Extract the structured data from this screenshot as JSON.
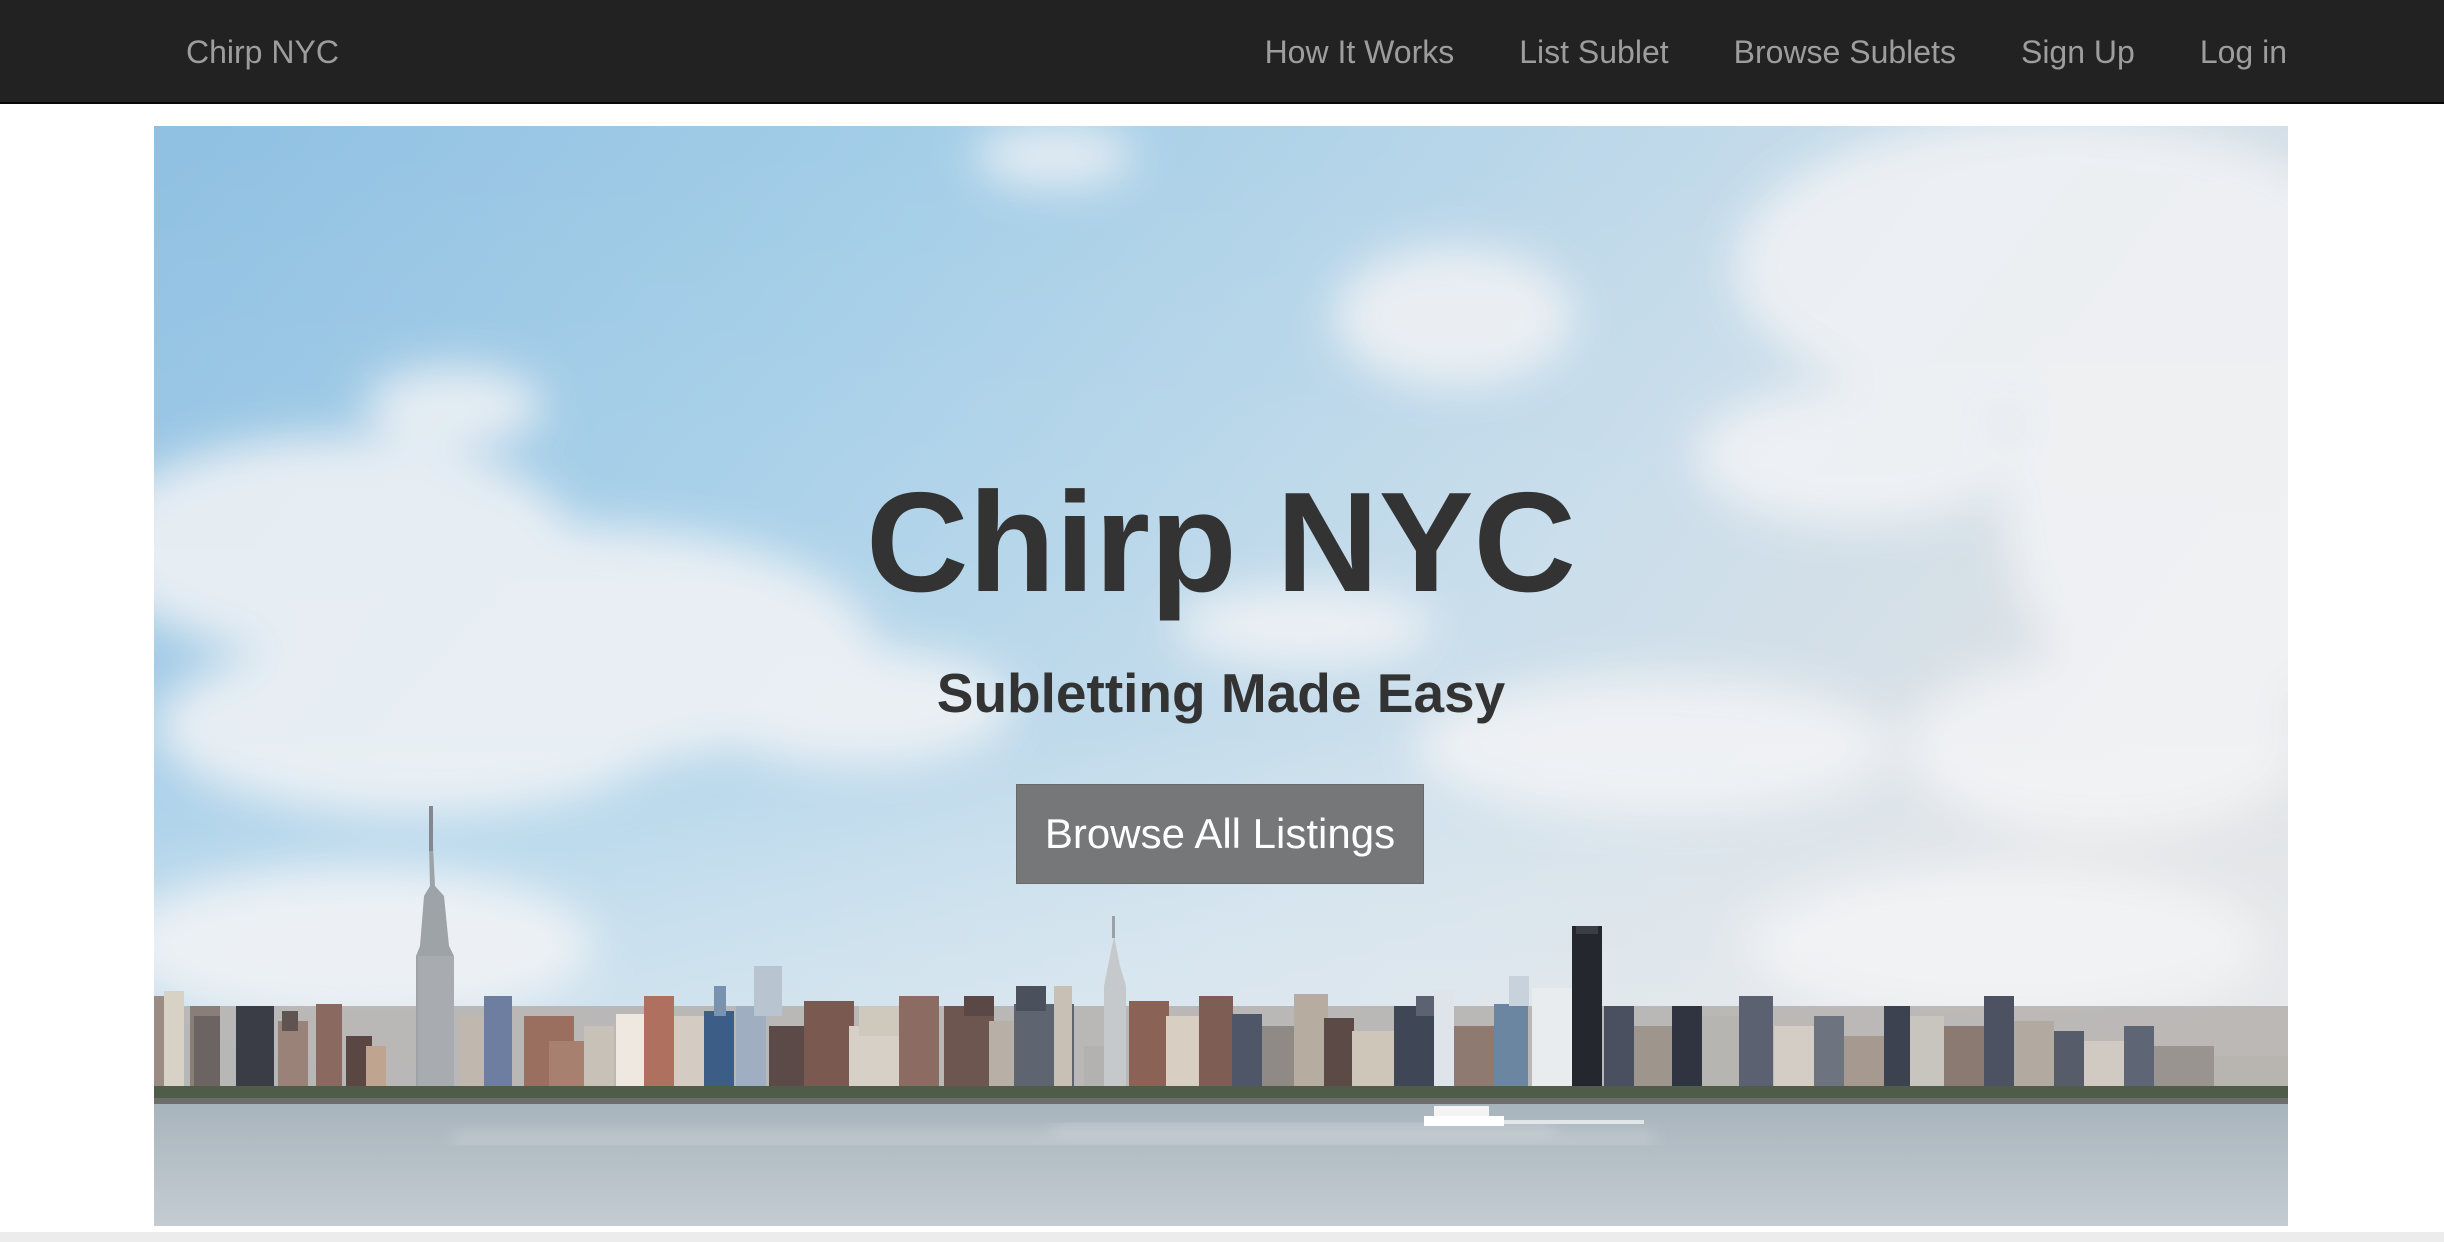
{
  "navbar": {
    "brand": "Chirp NYC",
    "links": [
      {
        "label": "How It Works"
      },
      {
        "label": "List Sublet"
      },
      {
        "label": "Browse Sublets"
      },
      {
        "label": "Sign Up"
      },
      {
        "label": "Log in"
      }
    ]
  },
  "hero": {
    "title": "Chirp NYC",
    "subtitle": "Subletting Made Easy",
    "cta_label": "Browse All Listings"
  },
  "colors": {
    "navbar_bg": "#222222",
    "nav_text": "#9d9d9d",
    "hero_text": "#333333",
    "button_bg": "#6e6e6e",
    "button_text": "#ffffff"
  }
}
